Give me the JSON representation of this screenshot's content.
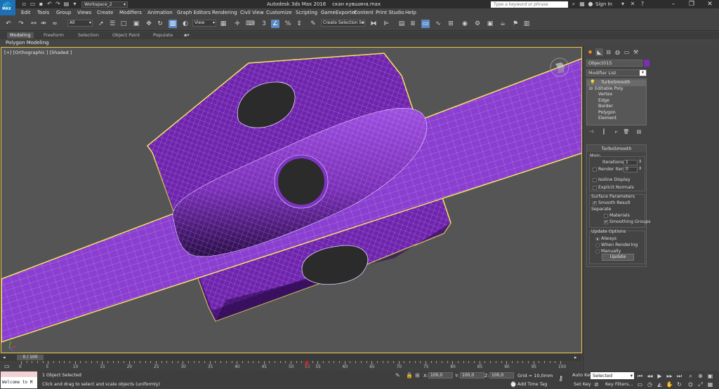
{
  "titlebar": {
    "app_logo_text": "MAX",
    "workspace": "Workspace_2",
    "app_title": "Autodesk 3ds Max 2016",
    "file_name": "скан кувшина.max",
    "search_placeholder": "Type a keyword or phrase",
    "sign_in": "Sign In"
  },
  "menu": [
    "Edit",
    "Tools",
    "Group",
    "Views",
    "Create",
    "Modifiers",
    "Animation",
    "Graph Editors",
    "Rendering",
    "Civil View",
    "Customize",
    "Scripting",
    "GameExporter",
    "Content",
    "Print Studio",
    "Help"
  ],
  "toolbar": {
    "filter_select": "All",
    "ref_coord_select": "View",
    "named_selection_placeholder": "Create Selection Se"
  },
  "ribbon": {
    "tabs": [
      "Modeling",
      "Freeform",
      "Selection",
      "Object Paint",
      "Populate"
    ],
    "active_tab": "Modeling",
    "panel_label": "Polygon Modeling"
  },
  "viewport": {
    "label": "[+] [Orthographic ] [Shaded ]",
    "wire_color": "#7a2fb8",
    "selection_color": "#f5e35c"
  },
  "command_panel": {
    "object_name": "Object015",
    "object_color": "#7a2fb8",
    "modifier_list": "Modifier List",
    "stack": [
      "TurboSmooth",
      "Editable Poly",
      "Vertex",
      "Edge",
      "Border",
      "Polygon",
      "Element"
    ],
    "rollout": {
      "title": "TurboSmooth",
      "main_label": "Main",
      "iterations_label": "Iterations:",
      "iterations_value": "1",
      "render_iters_label": "Render Iters:",
      "render_iters_value": "0",
      "isoline_label": "Isoline Display",
      "explicit_normals_label": "Explicit Normals",
      "surface_params_label": "Surface Parameters",
      "smooth_result_label": "Smooth Result",
      "separate_label": "Separate",
      "materials_label": "Materials",
      "smoothing_groups_label": "Smoothing Groups",
      "update_options_label": "Update Options",
      "always_label": "Always",
      "when_rendering_label": "When Rendering",
      "manually_label": "Manually",
      "update_button": "Update",
      "check_mark": "✔"
    }
  },
  "timeline": {
    "thumb": "0 / 100",
    "ticks": [
      "0",
      "5",
      "10",
      "15",
      "20",
      "25",
      "30",
      "35",
      "40",
      "45",
      "50",
      "55",
      "60",
      "65",
      "70",
      "75",
      "80",
      "85",
      "90",
      "95",
      "100"
    ],
    "current_frame": "53"
  },
  "status": {
    "maxscript": "Welcome to M",
    "line1": "1 Object Selected",
    "line2": "Click and drag to select and scale objects (uniformly)",
    "x_label": "X:",
    "x_value": "100,0",
    "y_label": "Y:",
    "y_value": "100,0",
    "z_label": "Z:",
    "z_value": "100,0",
    "grid": "Grid = 10,0mm",
    "add_time_tag": "Add Time Tag",
    "auto_key": "Auto Key",
    "set_key": "Set Key",
    "selected_dropdown": "Selected",
    "key_filters": "Key Filters..."
  }
}
